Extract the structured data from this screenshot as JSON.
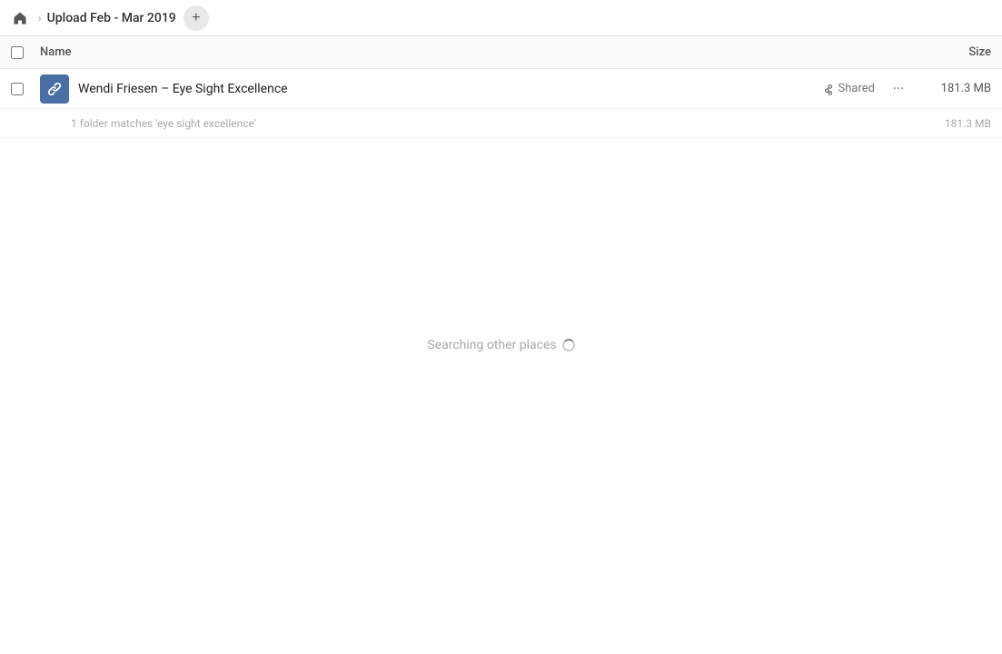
{
  "header": {
    "home_icon": "home-icon",
    "breadcrumb_title": "Upload Feb - Mar 2019",
    "add_button_label": "+"
  },
  "columns": {
    "name_label": "Name",
    "size_label": "Size"
  },
  "files": [
    {
      "id": 1,
      "name": "Wendi Friesen – Eye Sight Excellence",
      "icon_type": "link-file-icon",
      "shared": true,
      "shared_label": "Shared",
      "size": "181.3 MB",
      "sub_text": "1 folder matches 'eye sight excellence'",
      "sub_size": "181.3 MB"
    }
  ],
  "searching": {
    "label": "Searching other places"
  }
}
